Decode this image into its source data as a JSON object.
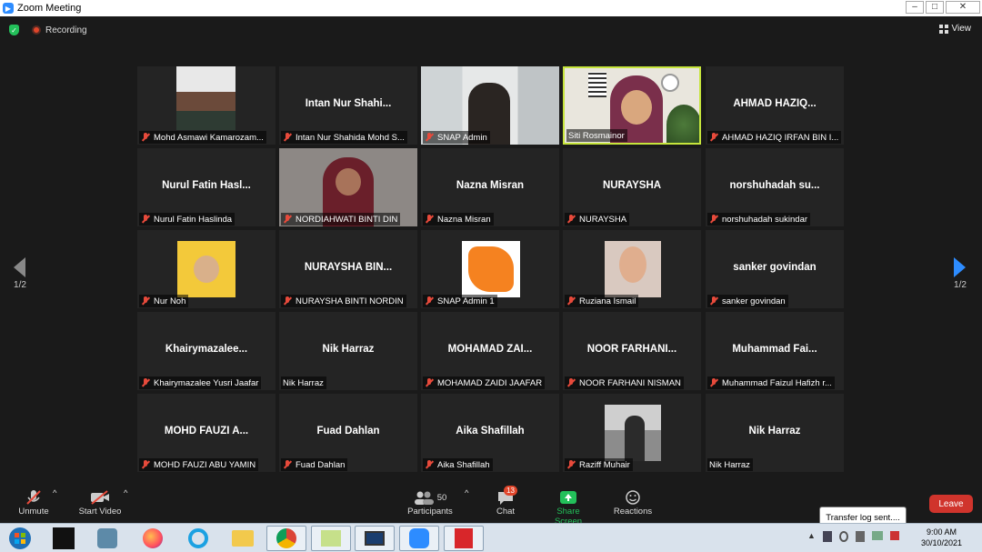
{
  "window": {
    "title": "Zoom Meeting",
    "controls": [
      "–",
      "□",
      "✕"
    ]
  },
  "status": {
    "recording_label": "Recording",
    "view_label": "View"
  },
  "pager": {
    "left": "1/2",
    "right": "1/2"
  },
  "tiles": [
    {
      "center": "",
      "label": "Mohd Asmawi Kamarozam...",
      "muted": true
    },
    {
      "center": "Intan Nur Shahi...",
      "label": "Intan Nur Shahida Mohd S...",
      "muted": true
    },
    {
      "center": "",
      "label": "SNAP Admin",
      "muted": true
    },
    {
      "center": "",
      "label": "Siti Rosmainor",
      "muted": false
    },
    {
      "center": "AHMAD HAZIQ...",
      "label": "AHMAD HAZIQ IRFAN BIN I...",
      "muted": true
    },
    {
      "center": "Nurul Fatin Hasl...",
      "label": "Nurul Fatin Haslinda",
      "muted": true
    },
    {
      "center": "",
      "label": "NORDIAHWATI BINTI DIN",
      "muted": true
    },
    {
      "center": "Nazna Misran",
      "label": "Nazna Misran",
      "muted": true
    },
    {
      "center": "NURAYSHA",
      "label": "NURAYSHA",
      "muted": true
    },
    {
      "center": "norshuhadah su...",
      "label": "norshuhadah sukindar",
      "muted": true
    },
    {
      "center": "",
      "label": "Nur Noh",
      "muted": true
    },
    {
      "center": "NURAYSHA BIN...",
      "label": "NURAYSHA BINTI NORDIN",
      "muted": true
    },
    {
      "center": "",
      "label": "SNAP Admin 1",
      "muted": true
    },
    {
      "center": "",
      "label": "Ruziana Ismail",
      "muted": true
    },
    {
      "center": "sanker govindan",
      "label": "sanker govindan",
      "muted": true
    },
    {
      "center": "Khairymazalee...",
      "label": "Khairymazalee Yusri Jaafar",
      "muted": true
    },
    {
      "center": "Nik Harraz",
      "label": "Nik Harraz",
      "muted": false
    },
    {
      "center": "MOHAMAD ZAI...",
      "label": "MOHAMAD ZAIDI JAAFAR",
      "muted": true
    },
    {
      "center": "NOOR FARHANI...",
      "label": "NOOR FARHANI NISMAN",
      "muted": true
    },
    {
      "center": "Muhammad Fai...",
      "label": "Muhammad Faizul Hafizh r...",
      "muted": true
    },
    {
      "center": "MOHD FAUZI A...",
      "label": "MOHD FAUZI ABU YAMIN",
      "muted": true
    },
    {
      "center": "Fuad Dahlan",
      "label": "Fuad Dahlan",
      "muted": true
    },
    {
      "center": "Aika Shafillah",
      "label": "Aika Shafillah",
      "muted": true
    },
    {
      "center": "",
      "label": "Raziff Muhair",
      "muted": true
    },
    {
      "center": "Nik Harraz",
      "label": "Nik Harraz",
      "muted": false
    }
  ],
  "toolbar": {
    "unmute": "Unmute",
    "start_video": "Start Video",
    "participants": "Participants",
    "participants_count": "50",
    "chat": "Chat",
    "chat_badge": "13",
    "share_screen": "Share Screen",
    "reactions": "Reactions",
    "leave": "Leave"
  },
  "taskbar": {
    "tooltip": "Transfer log sent....",
    "time": "9:00 AM",
    "date": "30/10/2021"
  },
  "colors": {
    "accent_green": "#23c05a",
    "leave_red": "#d0342c",
    "active_speaker": "#c6e53c",
    "arrow_blue": "#2d8cff"
  }
}
